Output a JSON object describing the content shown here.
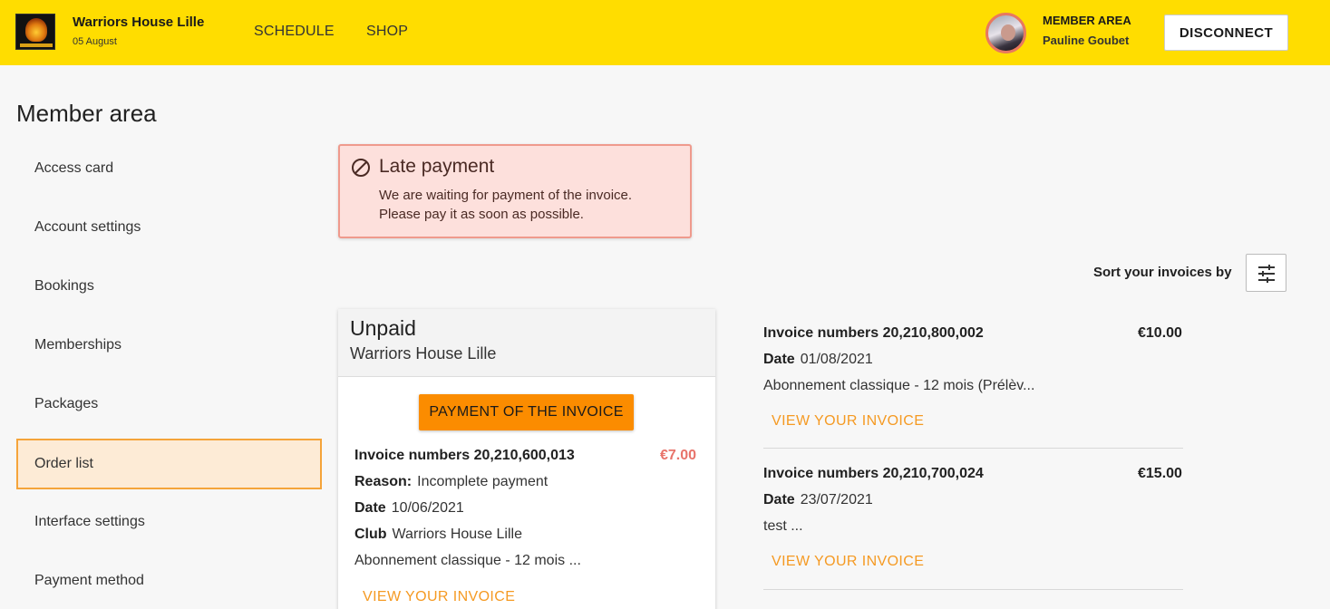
{
  "header": {
    "club_name": "Warriors House Lille",
    "date": "05 August",
    "nav": [
      "SCHEDULE",
      "SHOP"
    ],
    "member_area_label": "MEMBER AREA",
    "member_name": "Pauline Goubet",
    "disconnect_label": "DISCONNECT"
  },
  "page": {
    "title": "Member area"
  },
  "sidebar": {
    "items": [
      {
        "label": "Access card",
        "active": false
      },
      {
        "label": "Account settings",
        "active": false
      },
      {
        "label": "Bookings",
        "active": false
      },
      {
        "label": "Memberships",
        "active": false
      },
      {
        "label": "Packages",
        "active": false
      },
      {
        "label": "Order list",
        "active": true
      },
      {
        "label": "Interface settings",
        "active": false
      },
      {
        "label": "Payment method",
        "active": false
      }
    ]
  },
  "alert": {
    "title": "Late payment",
    "line1": "We are waiting for payment of the invoice.",
    "line2": "Please pay it as soon as possible."
  },
  "sort": {
    "label": "Sort your invoices by"
  },
  "unpaid": {
    "title": "Unpaid",
    "club": "Warriors House Lille",
    "pay_button": "PAYMENT OF THE INVOICE",
    "invoice_label": "Invoice numbers 20,210,600,013",
    "amount": "€7.00",
    "reason_label": "Reason:",
    "reason_value": "Incomplete payment",
    "date_label": "Date",
    "date_value": "10/06/2021",
    "club_label": "Club",
    "club_value": "Warriors House Lille",
    "description": "Abonnement classique - 12 mois ...",
    "view_link": "VIEW YOUR INVOICE"
  },
  "invoices": [
    {
      "number_label": "Invoice numbers 20,210,800,002",
      "amount": "€10.00",
      "date_label": "Date",
      "date_value": "01/08/2021",
      "description": "Abonnement classique - 12 mois (Prélèv...",
      "view_link": "VIEW YOUR INVOICE"
    },
    {
      "number_label": "Invoice numbers 20,210,700,024",
      "amount": "€15.00",
      "date_label": "Date",
      "date_value": "23/07/2021",
      "description": "test ...",
      "view_link": "VIEW YOUR INVOICE"
    }
  ],
  "colors": {
    "header_bg": "#ffdd00",
    "accent_orange": "#fb8c00",
    "link_orange": "#f59a23",
    "alert_bg": "#fde0dc",
    "unpaid_amount": "#e8736a"
  },
  "icons": [
    "avatar",
    "forbidden-icon",
    "tune-icon",
    "club-logo"
  ]
}
